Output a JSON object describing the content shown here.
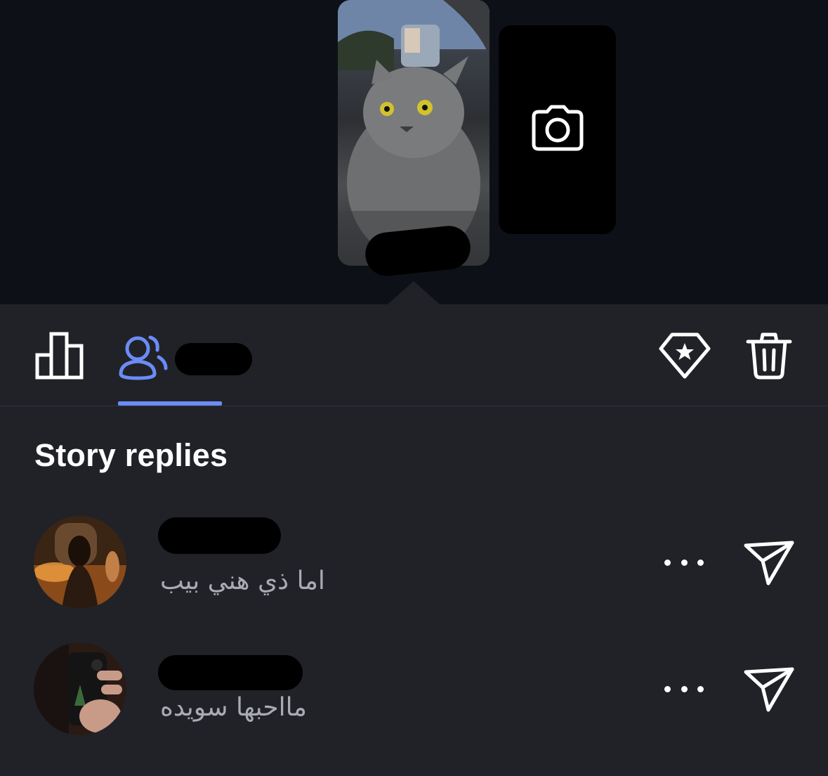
{
  "story_preview": {
    "thumbnail_subject": "grey cat in car",
    "add_story_icon": "camera-icon"
  },
  "toolbar": {
    "insights_icon": "bar-chart-icon",
    "viewers_icon": "people-icon",
    "highlight_icon": "diamond-star-icon",
    "delete_icon": "trash-icon",
    "active_tab": "viewers",
    "accent_color": "#6b8cf5"
  },
  "replies_section": {
    "title": "Story replies",
    "items": [
      {
        "username": "",
        "message": "اما ذي هني بيب",
        "more_icon": "more-horizontal-icon",
        "send_icon": "send-icon"
      },
      {
        "username": "",
        "message": "مااحبها سويده",
        "more_icon": "more-horizontal-icon",
        "send_icon": "send-icon"
      }
    ]
  }
}
